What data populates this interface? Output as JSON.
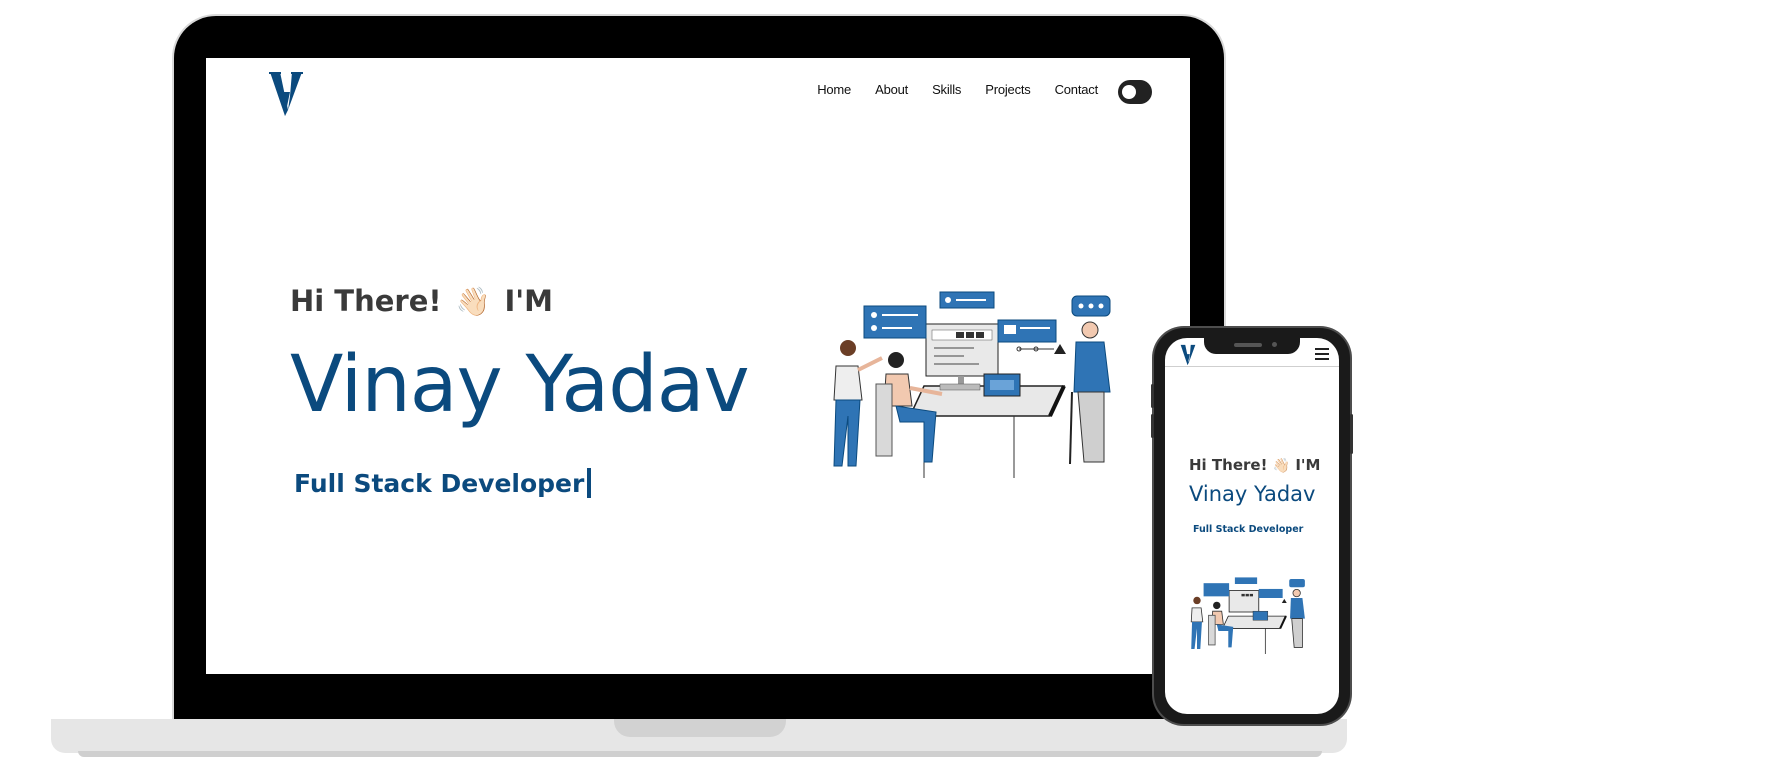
{
  "brand": {
    "logo_letter": "V",
    "primary_color": "#0b4a7e",
    "accent_color": "#2f74b5"
  },
  "nav": {
    "items": [
      {
        "label": "Home"
      },
      {
        "label": "About"
      },
      {
        "label": "Skills"
      },
      {
        "label": "Projects"
      },
      {
        "label": "Contact"
      }
    ],
    "theme_toggle_icon": "toggle-switch-icon"
  },
  "hero": {
    "greeting": "Hi There!",
    "greeting_suffix": "I'M",
    "wave_icon": "👋🏻",
    "name": "Vinay Yadav",
    "role": "Full Stack Developer"
  },
  "mobile": {
    "greeting": "Hi There!",
    "greeting_suffix": "I'M",
    "wave_icon": "👋🏻",
    "name": "Vinay Yadav",
    "role": "Full Stack Developer",
    "menu_icon": "hamburger-menu-icon"
  }
}
